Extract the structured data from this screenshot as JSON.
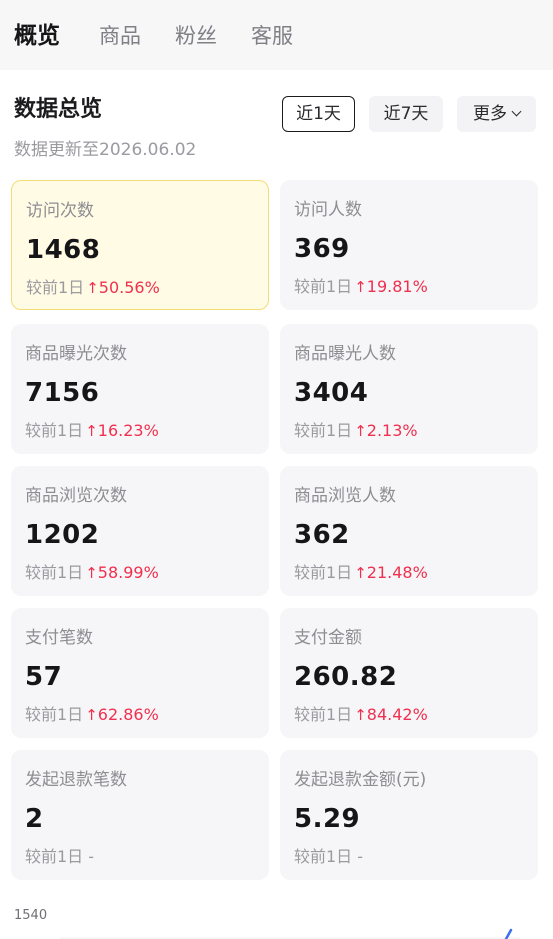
{
  "nav": {
    "tabs": [
      "概览",
      "商品",
      "粉丝",
      "客服"
    ],
    "active_index": 0
  },
  "overview": {
    "title": "数据总览",
    "update_text": "数据更新至2026.06.02",
    "ranges": [
      "近1天",
      "近7天",
      "更多"
    ],
    "selected_range_index": 0
  },
  "metrics": [
    {
      "label": "访问次数",
      "value": "1468",
      "compare_prefix": "较前1日",
      "delta": "50.56%",
      "direction": "up",
      "highlighted": true
    },
    {
      "label": "访问人数",
      "value": "369",
      "compare_prefix": "较前1日",
      "delta": "19.81%",
      "direction": "up",
      "highlighted": false
    },
    {
      "label": "商品曝光次数",
      "value": "7156",
      "compare_prefix": "较前1日",
      "delta": "16.23%",
      "direction": "up",
      "highlighted": false
    },
    {
      "label": "商品曝光人数",
      "value": "3404",
      "compare_prefix": "较前1日",
      "delta": "2.13%",
      "direction": "up",
      "highlighted": false
    },
    {
      "label": "商品浏览次数",
      "value": "1202",
      "compare_prefix": "较前1日",
      "delta": "58.99%",
      "direction": "up",
      "highlighted": false
    },
    {
      "label": "商品浏览人数",
      "value": "362",
      "compare_prefix": "较前1日",
      "delta": "21.48%",
      "direction": "up",
      "highlighted": false
    },
    {
      "label": "支付笔数",
      "value": "57",
      "compare_prefix": "较前1日",
      "delta": "62.86%",
      "direction": "up",
      "highlighted": false
    },
    {
      "label": "支付金额",
      "value": "260.82",
      "compare_prefix": "较前1日",
      "delta": "84.42%",
      "direction": "up",
      "highlighted": false
    },
    {
      "label": "发起退款笔数",
      "value": "2",
      "compare_prefix": "较前1日 -",
      "delta": "",
      "direction": "none",
      "highlighted": false
    },
    {
      "label": "发起退款金额(元)",
      "value": "5.29",
      "compare_prefix": "较前1日 -",
      "delta": "",
      "direction": "none",
      "highlighted": false
    }
  ],
  "chart": {
    "y_tick_top": "1540"
  },
  "colors": {
    "up": "#f0304f",
    "highlight_bg": "#fffbe4",
    "highlight_border": "#f2dd7a"
  },
  "icons": {
    "up_arrow": "↑",
    "more_chevron": "chevron-down-icon"
  }
}
